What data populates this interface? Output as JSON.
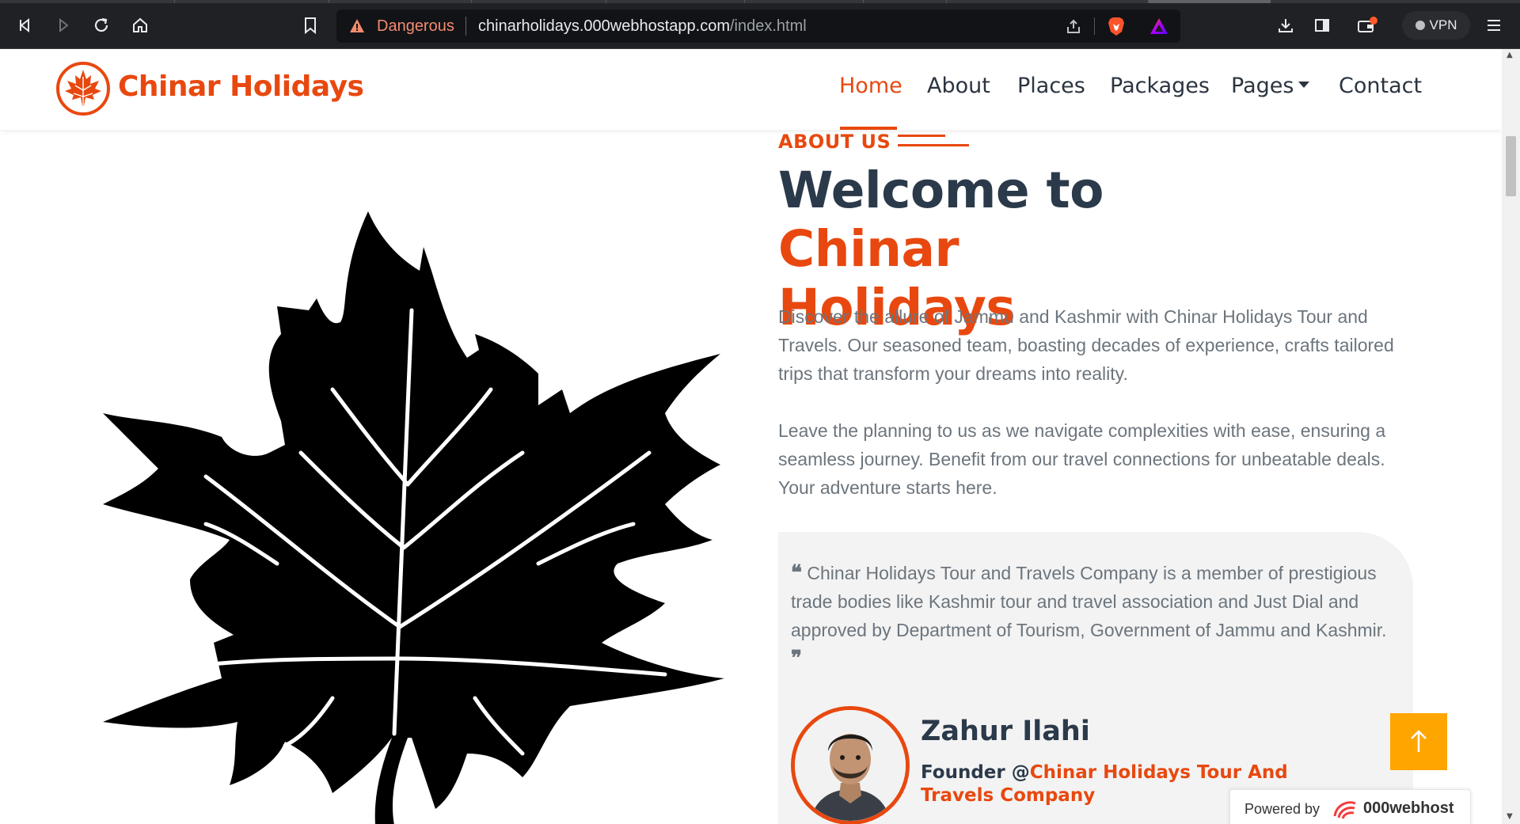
{
  "browser": {
    "security_label": "Dangerous",
    "url_host": "chinarholidays.000webhostapp.com",
    "url_path": "/index.html",
    "vpn_label": "VPN",
    "warning_color": "#f28b6f"
  },
  "navbar": {
    "brand": "Chinar Holidays",
    "items": [
      {
        "label": "Home",
        "active": true
      },
      {
        "label": "About"
      },
      {
        "label": "Places"
      },
      {
        "label": "Packages"
      },
      {
        "label": "Pages"
      },
      {
        "label": "Contact"
      }
    ]
  },
  "about": {
    "eyebrow": "ABOUT US",
    "heading_prefix": "Welcome to",
    "heading_accent_1": "Chinar",
    "heading_accent_2": "Holidays",
    "para1": "Discover the allure of Jammu and Kashmir with Chinar Holidays Tour and Travels. Our seasoned team, boasting decades of experience, crafts tailored trips that transform your dreams into reality.",
    "para2": "Leave the planning to us as we navigate complexities with ease, ensuring a seamless journey. Benefit from our travel connections for unbeatable deals. Your adventure starts here."
  },
  "testimonial": {
    "quote": "Chinar Holidays Tour and Travels Company is a member of prestigious trade bodies like Kashmir tour and travel association and Just Dial and approved by Department of Tourism, Government of Jammu and Kashmir.",
    "name": "Zahur Ilahi",
    "role_prefix": "Founder @",
    "role_company": "Chinar Holidays Tour And Travels Company"
  },
  "footer_badge": {
    "label": "Powered by",
    "brand": "000webhost"
  },
  "colors": {
    "accent": "#e8480f",
    "heading": "#2b3a4a",
    "body_text": "#6c757d",
    "to_top": "#ffa500"
  }
}
